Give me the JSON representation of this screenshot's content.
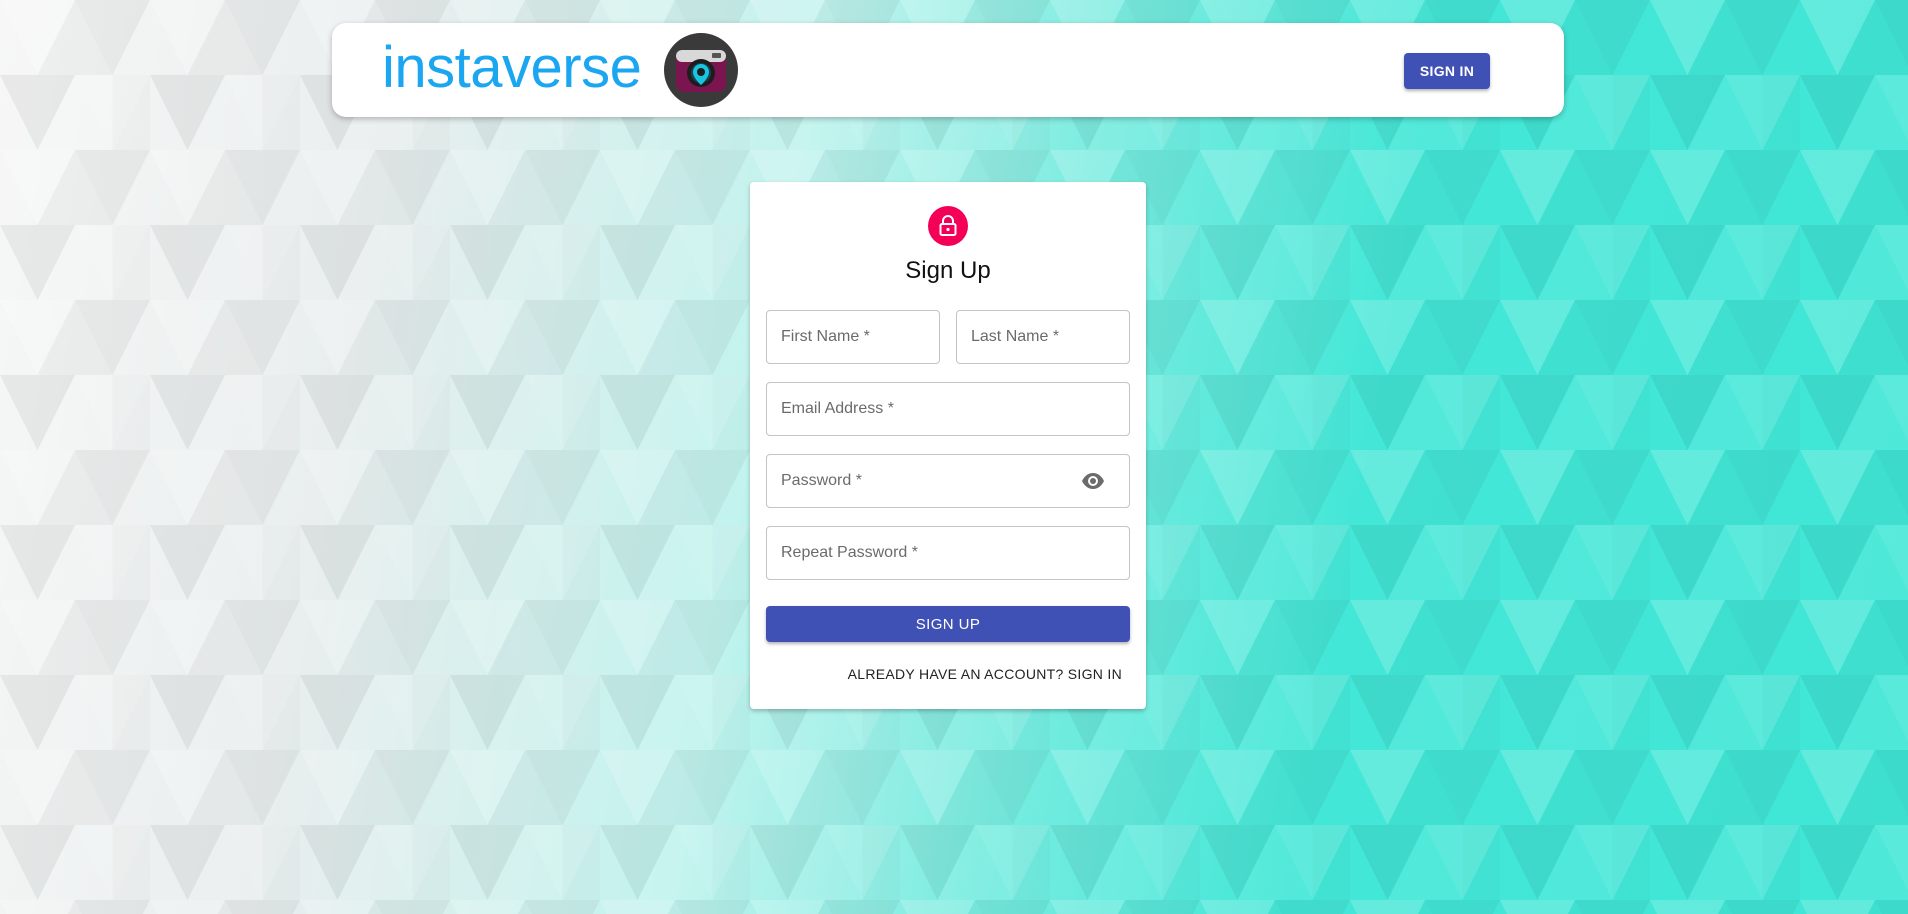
{
  "header": {
    "logo_text": "instaverse",
    "logo_icon": "camera-logo-icon",
    "signin_label": "SIGN IN"
  },
  "form": {
    "lock_icon": "lock-icon",
    "title": "Sign Up",
    "first_name_placeholder": "First Name *",
    "last_name_placeholder": "Last Name *",
    "email_placeholder": "Email Address *",
    "password_placeholder": "Password *",
    "password_toggle_icon": "eye-icon",
    "repeat_password_placeholder": "Repeat Password *",
    "submit_label": "SIGN UP",
    "switch_link": "ALREADY HAVE AN ACCOUNT? SIGN IN"
  },
  "colors": {
    "brand_text": "#1aa6f0",
    "primary_button": "#3f51b5",
    "avatar": "#f50057",
    "background_left": "#f7f7f7",
    "background_right": "#3fe6d6"
  }
}
